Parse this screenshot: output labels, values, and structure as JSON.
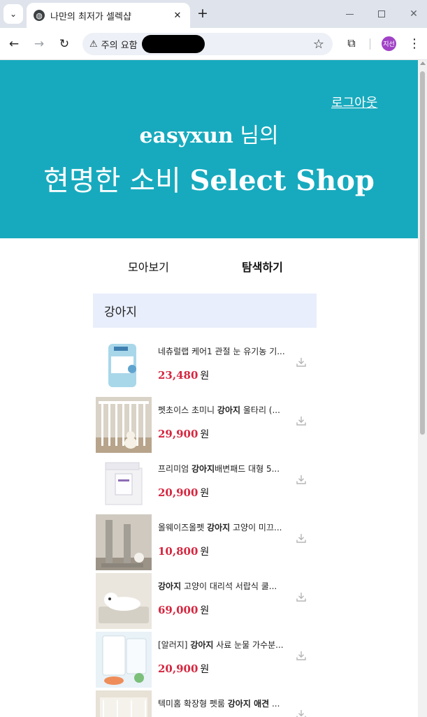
{
  "browser": {
    "tab_title": "나만의 최저가 셀렉샵",
    "omnibox_warning": "주의 요함",
    "profile_initials": "지선"
  },
  "header": {
    "logout": "로그아웃",
    "username": "easyxun",
    "username_suffix": "님의",
    "title_ko": "현명한 소비",
    "title_en": "Select Shop",
    "bg_color": "#17aabe"
  },
  "nav": {
    "tabs": [
      {
        "label": "모아보기"
      },
      {
        "label": "탐색하기"
      }
    ],
    "active": "탐색하기"
  },
  "search": {
    "keyword": "강아지"
  },
  "products": [
    {
      "name_pre": "네츄럴랩 케어1 관절 눈 유기농 기...",
      "name_bold": "",
      "name_post": "",
      "price": "23,480",
      "unit": "원"
    },
    {
      "name_pre": "펫초이스 초미니 ",
      "name_bold": "강아지",
      "name_post": " 울타리 (...",
      "price": "29,900",
      "unit": "원"
    },
    {
      "name_pre": "프리미엄 ",
      "name_bold": "강아지",
      "name_post": "배변패드 대형 5...",
      "price": "20,900",
      "unit": "원"
    },
    {
      "name_pre": "올웨이즈올펫 ",
      "name_bold": "강아지",
      "name_post": " 고양이 미끄...",
      "price": "10,800",
      "unit": "원"
    },
    {
      "name_pre": "",
      "name_bold": "강아지",
      "name_post": " 고양이 대리석 서랍식 쿨...",
      "price": "69,000",
      "unit": "원"
    },
    {
      "name_pre": "[알러지] ",
      "name_bold": "강아지",
      "name_post": " 사료 눈물 가수분...",
      "price": "20,900",
      "unit": "원"
    },
    {
      "name_pre": "텍미홈 확장형 펫룸 ",
      "name_bold": "강아지 애견",
      "name_post": " ...",
      "price": "",
      "unit": ""
    }
  ],
  "colors": {
    "accent": "#17aabe",
    "price": "#d6263f",
    "keyword_bg": "#e8eefb"
  }
}
